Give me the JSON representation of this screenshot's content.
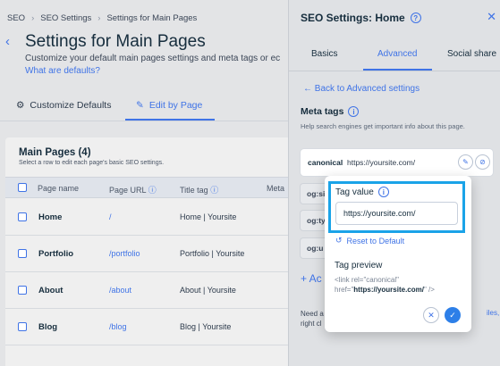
{
  "breadcrumb": {
    "items": [
      "SEO",
      "SEO Settings",
      "Settings for Main Pages"
    ]
  },
  "page": {
    "title": "Settings for Main Pages",
    "subtitle": "Customize your default main pages settings and meta tags or ec",
    "defaults_link": "What are defaults?"
  },
  "tabs": {
    "customize": "Customize Defaults",
    "edit_by_page": "Edit by Page"
  },
  "table": {
    "title": "Main Pages (4)",
    "subtitle": "Select a row to edit each page's basic SEO settings.",
    "headers": [
      "Page name",
      "Page URL",
      "Title tag",
      "Meta"
    ],
    "rows": [
      {
        "name": "Home",
        "url": "/",
        "title": "Home | Yoursite"
      },
      {
        "name": "Portfolio",
        "url": "/portfolio",
        "title": "Portfolio | Yoursite"
      },
      {
        "name": "About",
        "url": "/about",
        "title": "About | Yoursite"
      },
      {
        "name": "Blog",
        "url": "/blog",
        "title": "Blog | Yoursite"
      }
    ]
  },
  "panel": {
    "title": "SEO Settings: Home",
    "tabs": [
      "Basics",
      "Advanced",
      "Social share"
    ],
    "back_link": "Back to Advanced settings",
    "meta_label": "Meta tags",
    "meta_help": "Help search engines get important info about this page.",
    "canonical_key": "canonical",
    "canonical_value": "https://yoursite.com/",
    "og_keys": [
      "og:si",
      "og:ty",
      "og:u"
    ],
    "add_fragment": "+ Ac",
    "need_fragment": "Need a",
    "right_fragment": "right cl",
    "link_fragment": "iles,"
  },
  "popover": {
    "label": "Tag value",
    "input_value": "https://yoursite.com/",
    "reset": "Reset to Default",
    "preview_label": "Tag preview",
    "preview_prefix": "<link rel=\"canonical\" href=\"",
    "preview_url": "https://yoursite.com/",
    "preview_suffix": "\" />"
  },
  "colors": {
    "accent": "#3f73e6",
    "highlight": "#1aa3e8",
    "text": "#162d3d"
  }
}
